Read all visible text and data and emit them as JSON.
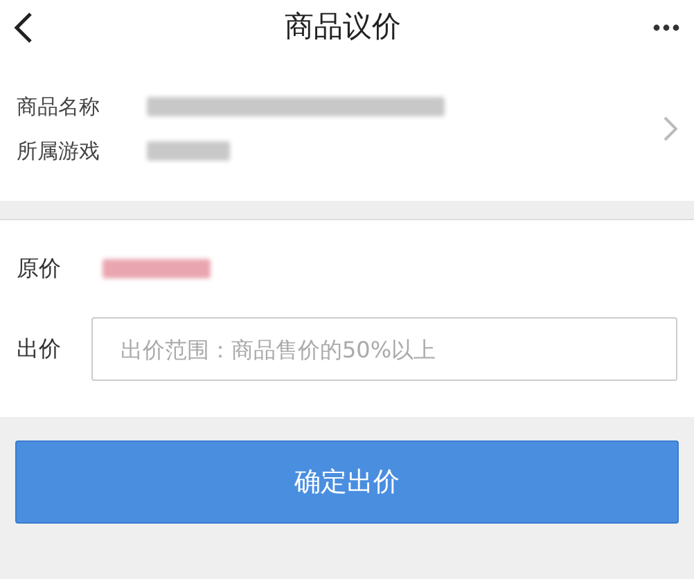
{
  "header": {
    "title": "商品议价"
  },
  "product": [
    {
      "label": "商品名称"
    },
    {
      "label": "所属游戏"
    }
  ],
  "price": {
    "label": "原价"
  },
  "offer": {
    "label": "出价",
    "placeholder": "出价范围：商品售价的50%以上"
  },
  "submit": {
    "label": "确定出价"
  }
}
